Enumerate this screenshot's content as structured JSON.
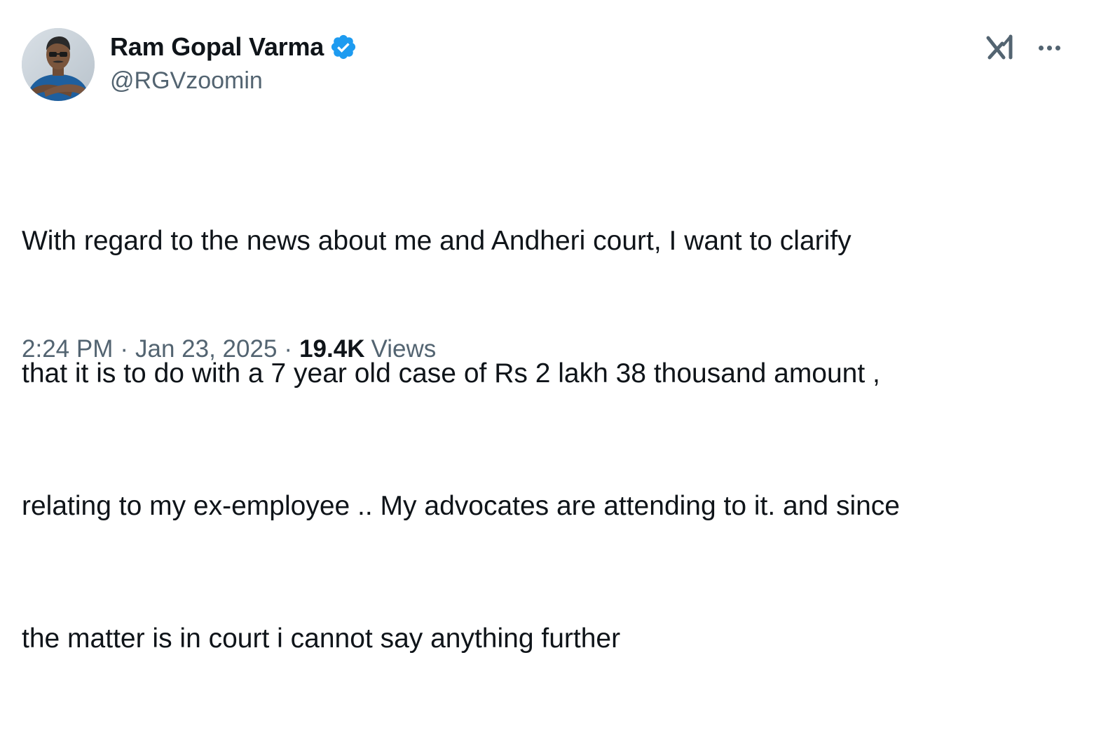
{
  "tweet": {
    "author": {
      "display_name": "Ram Gopal Varma",
      "handle": "@RGVzoomin",
      "verified": true
    },
    "text_lines": [
      "With regard to the news about me and Andheri court, I want to clarify",
      "that it is to do with a 7 year old case of Rs 2 lakh 38 thousand amount ,",
      "relating to my ex-employee .. My advocates are attending to it. and since",
      "the matter is in court i cannot say anything further"
    ],
    "time": "2:24 PM",
    "separator": "·",
    "date": "Jan 23, 2025",
    "views_count": "19.4K",
    "views_label": "Views"
  },
  "icons": {
    "verified": "verified-badge-icon",
    "grok": "grok-icon",
    "more": "more-options-icon"
  },
  "colors": {
    "text_primary": "#0f1419",
    "text_secondary": "#536471",
    "verified_blue": "#1d9bf0",
    "background": "#ffffff"
  }
}
